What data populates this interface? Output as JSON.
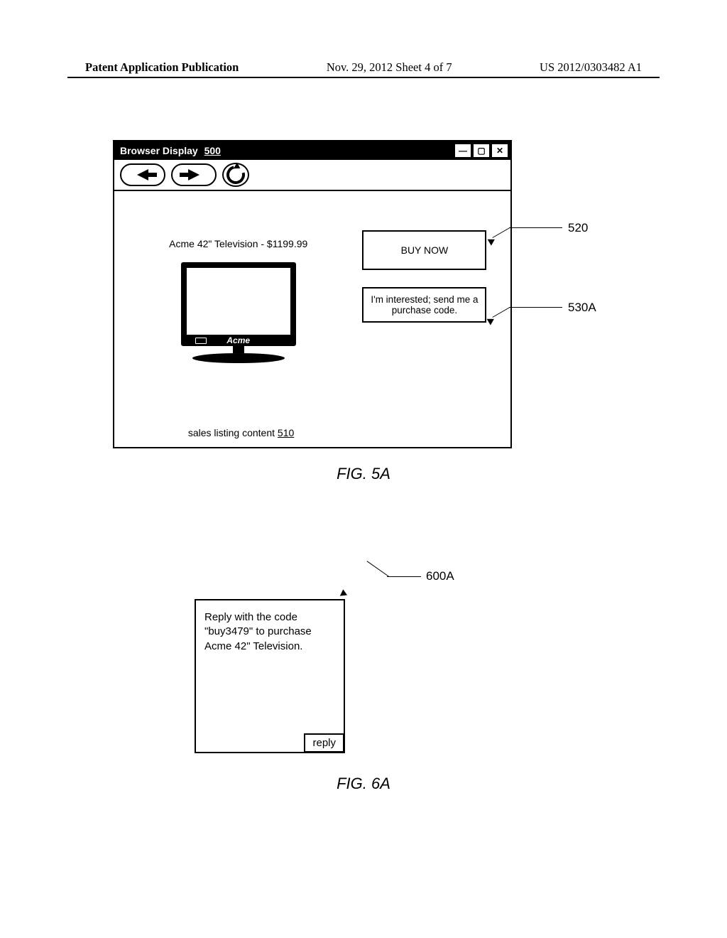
{
  "header": {
    "left": "Patent Application Publication",
    "center": "Nov. 29, 2012  Sheet 4 of 7",
    "right": "US 2012/0303482 A1"
  },
  "browser": {
    "title_label": "Browser Display",
    "title_ref": "500",
    "product_title": "Acme 42\" Television - $1199.99",
    "tv_brand": "Acme",
    "sales_listing_label": "sales listing content",
    "sales_listing_ref": "510",
    "buy_now_label": "BUY NOW",
    "interested_label": "I'm interested; send me a purchase code."
  },
  "callouts": {
    "c520": "520",
    "c530a": "530A",
    "c600a": "600A"
  },
  "message_box": {
    "text": "Reply with the code \"buy3479\" to purchase Acme 42\" Television.",
    "reply_label": "reply"
  },
  "figures": {
    "fig5a": "FIG. 5A",
    "fig6a": "FIG. 6A"
  }
}
